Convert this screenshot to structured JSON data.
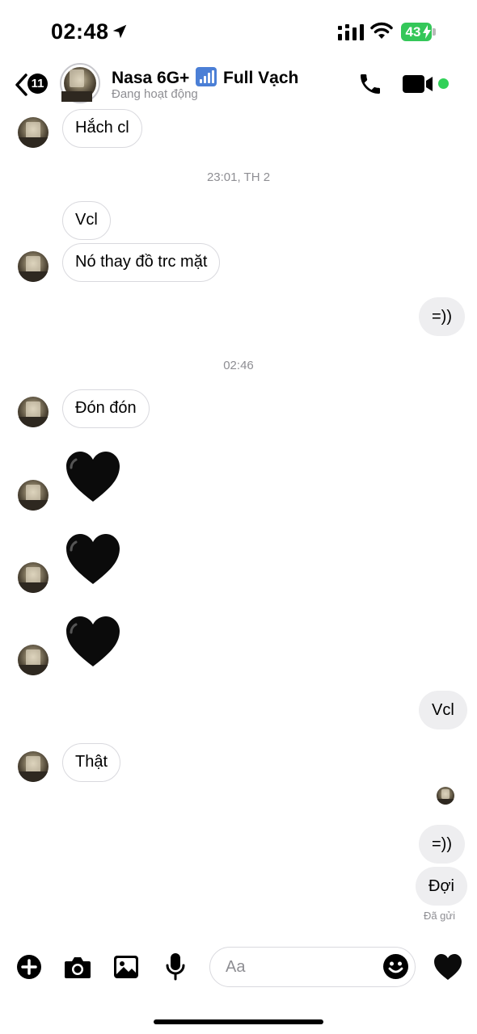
{
  "status_bar": {
    "time": "02:48",
    "battery": "43"
  },
  "header": {
    "back_count": "11",
    "name_part1": "Nasa 6G+",
    "name_part2": "Full Vạch",
    "status": "Đang hoạt động"
  },
  "messages": [
    {
      "side": "in",
      "text": "Hắch cl"
    },
    {
      "side": "timestamp",
      "text": "23:01, TH 2"
    },
    {
      "side": "in",
      "text": "Vcl"
    },
    {
      "side": "in",
      "text": "Nó thay đồ trc mặt"
    },
    {
      "side": "out",
      "text": "=))"
    },
    {
      "side": "timestamp",
      "text": "02:46"
    },
    {
      "side": "in",
      "text": "Đón đón"
    },
    {
      "side": "in",
      "emoji": "black-heart"
    },
    {
      "side": "in",
      "emoji": "black-heart"
    },
    {
      "side": "in",
      "emoji": "black-heart"
    },
    {
      "side": "out",
      "text": "Vcl"
    },
    {
      "side": "in",
      "text": "Thật"
    },
    {
      "side": "out",
      "text": "=))"
    },
    {
      "side": "out",
      "text": "Đợi"
    }
  ],
  "sent_status": "Đã gửi",
  "composer": {
    "placeholder": "Aa"
  },
  "colors": {
    "online": "#31d158",
    "battery": "#34c759",
    "outgoing_bubble": "#eeeef0",
    "incoming_border": "#d9d9de"
  },
  "icons": [
    "location-arrow-icon",
    "signal-icon",
    "wifi-icon",
    "back-chevron-icon",
    "phone-icon",
    "video-camera-icon",
    "plus-icon",
    "camera-icon",
    "gallery-icon",
    "microphone-icon",
    "emoji-icon",
    "heart-icon"
  ]
}
